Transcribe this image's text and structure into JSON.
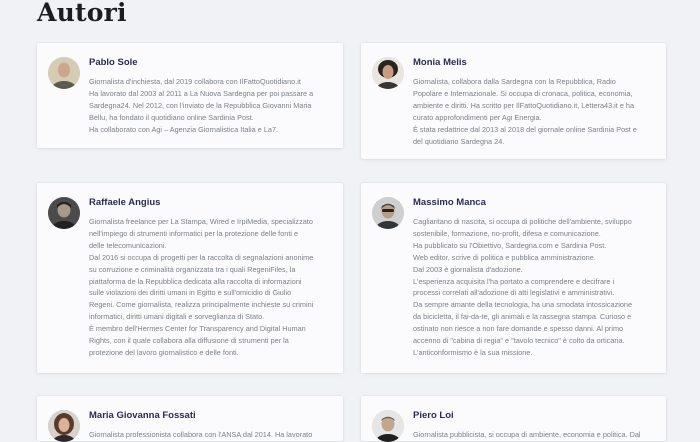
{
  "page": {
    "title": "Autori"
  },
  "authors": [
    {
      "name": "Pablo Sole",
      "bio_lines": [
        "Giornalista d'inchiesta, dal 2019 collabora con IlFattoQuotidiano.it",
        "Ha lavorato dal 2003 al 2011 a La Nuova Sardegna per poi passare a",
        "Sardegna24. Nel 2012, con l'inviato de la Repubblica Giovanni Maria",
        "Bellu, ha fondato il quotidiano online Sardinia Post.",
        "Ha collaborato con Agi – Agenzia Giornalistica Italia e La7."
      ]
    },
    {
      "name": "Monia Melis",
      "bio_lines": [
        "Giornalista, collabora dalla Sardegna con la Repubblica, Radio",
        "Popolare e Internazionale. Si occupa di cronaca, politica, economia,",
        "ambiente e diritti. Ha scritto per IlFattoQuotidiano.it, Lettera43.it e ha",
        "curato approfondimenti per Agi Energia.",
        "È stata redattrice dal 2013 al 2018 del giornale online Sardinia Post e",
        "del quotidiano Sardegna 24."
      ]
    },
    {
      "name": "Raffaele Angius",
      "bio_lines": [
        "Giornalista freelance per La Stampa, Wired e IrpiMedia, specializzato",
        "nell'impiego di strumenti informatici per la protezione delle fonti e",
        "delle telecomunicazioni.",
        "Dal 2016 si occupa di progetti per la raccolta di segnalazioni anonime",
        "su corruzione e criminalità organizzata tra i quali RegeniFiles, la",
        "piattaforma de la Repubblica dedicata alla raccolta di informazioni",
        "sulle violazioni dei diritti umani in Egitto e sull'omicidio di Giulio",
        "Regeni. Come giornalista, realizza principalmente inchieste su crimini",
        "informatici, diritti umani digitali e sorveglianza di Stato.",
        "È membro dell'Hermes Center for Transparency and Digital Human",
        "Rights, con il quale collabora alla diffusione di strumenti per la",
        "protezione del lavoro giornalistico e delle fonti."
      ]
    },
    {
      "name": "Massimo Manca",
      "bio_lines": [
        "Cagliaritano di nascita, si occupa di politiche dell'ambiente, sviluppo",
        "sostenibile, formazione, no-profit, difesa e comunicazione.",
        "Ha pubblicato su l'Obiettivo, Sardegna.com e Sardinia Post.",
        "Web editor, scrive di politica e pubblica amministrazione.",
        "Dal 2003 è giornalista d'adozione.",
        "L'esperienza acquisita l'ha portato a comprendere e decifrare i",
        "processi correlati all'adozione di atti legislativi e amministrativi.",
        "Da sempre amante della tecnologia, ha una smodata intossicazione",
        "da bicicletta, il fai-da-te, gli animali e la rassegna stampa. Curioso e",
        "ostinato non riesce a non fare domande e spesso danni. Al primo",
        "accenno di \"cabina di regia\" e \"tavolo tecnico\" è colto da orticaria.",
        "L'anticonformismo è la sua missione."
      ]
    },
    {
      "name": "Maria Giovanna Fossati",
      "bio_lines": [
        "Giornalista professionista collabora con l'ANSA dal 2014. Ha lavorato"
      ]
    },
    {
      "name": "Piero Loi",
      "bio_lines": [
        "Giornalista pubblicista, si occupa di ambiente, economia e politica. Dal"
      ]
    }
  ]
}
